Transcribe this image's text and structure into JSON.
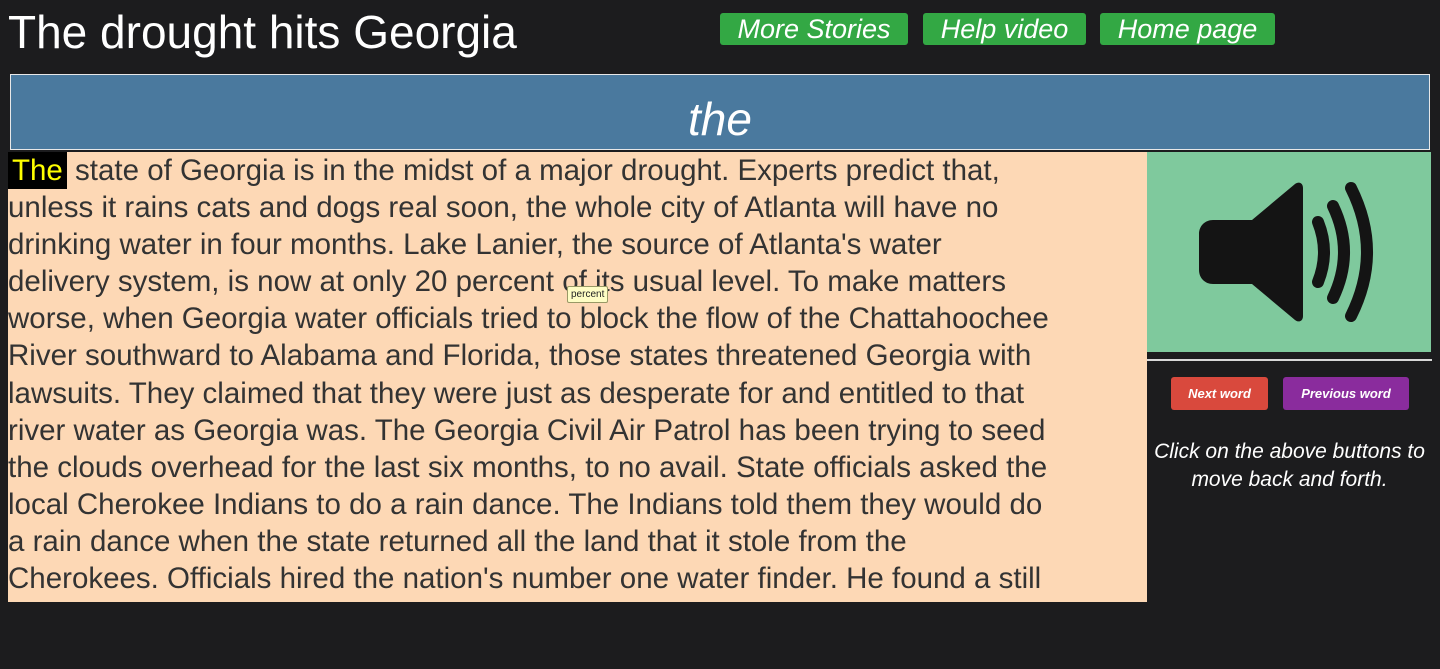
{
  "header": {
    "title": "The drought hits Georgia",
    "buttons": {
      "more_stories": "More Stories",
      "help_video": "Help video",
      "home_page": "Home page"
    }
  },
  "current_word_banner": "the",
  "story": {
    "highlighted_word": "The",
    "first_line_rest": " state of Georgia is in the midst of a major drought. Experts predict that,",
    "lines": [
      "unless it rains cats and dogs real soon, the whole city of Atlanta will have no",
      "drinking water in four months. Lake Lanier, the source of Atlanta's water",
      "delivery system, is now at only 20 percent of its usual level. To make matters",
      "worse, when Georgia water officials tried to block the flow of the Chattahoochee",
      "River southward to Alabama and Florida, those states threatened Georgia with",
      "lawsuits. They claimed that they were just as desperate for and entitled to that",
      "river water as Georgia was. The Georgia Civil Air Patrol has been trying to seed",
      "the clouds overhead for the last six months, to no avail. State officials asked the",
      "local Cherokee Indians to do a rain dance. The Indians told them they would do",
      "a rain dance when the state returned all the land that it stole from the",
      "Cherokees. Officials hired the nation's number one water finder. He found a still"
    ],
    "tooltip": "percent"
  },
  "side_panel": {
    "speaker_icon": "speaker-volume-icon",
    "next_word": "Next word",
    "previous_word": "Previous word",
    "instructions": "Click on the above buttons to move back and forth."
  },
  "colors": {
    "background": "#1c1c1e",
    "nav_button": "#33a844",
    "banner": "#4a799e",
    "reading_panel": "#fdd8b5",
    "highlight_bg": "#000000",
    "highlight_text": "#ffff00",
    "speaker_panel": "#7fc99d",
    "next_button": "#d9493d",
    "previous_button": "#8a2c9d"
  }
}
